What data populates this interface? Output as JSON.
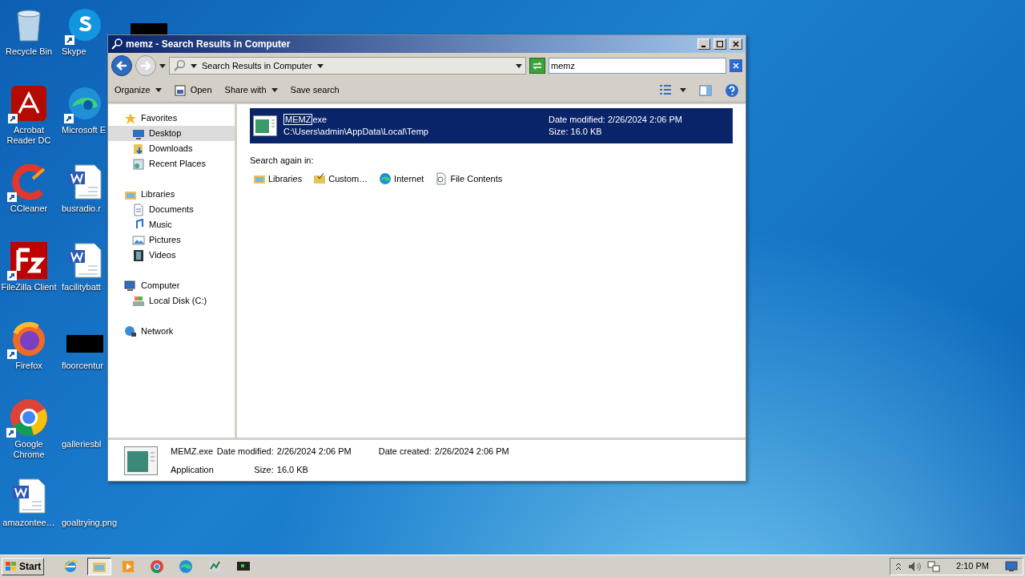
{
  "desktop_icons": [
    {
      "label": "Recycle Bin",
      "kind": "bin",
      "shortcut": false
    },
    {
      "label": "Skype",
      "kind": "skype",
      "shortcut": true
    },
    {
      "label": "Acrobat Reader DC",
      "kind": "acrobat",
      "shortcut": true
    },
    {
      "label": "Microsoft E",
      "kind": "edge",
      "shortcut": true
    },
    {
      "label": "CCleaner",
      "kind": "ccleaner",
      "shortcut": true
    },
    {
      "label": "busradio.r",
      "kind": "word",
      "shortcut": false
    },
    {
      "label": "FileZilla Client",
      "kind": "filezilla",
      "shortcut": true
    },
    {
      "label": "facilitybatt",
      "kind": "word",
      "shortcut": false
    },
    {
      "label": "Firefox",
      "kind": "firefox",
      "shortcut": true
    },
    {
      "label": "floorcentur",
      "kind": "redacted",
      "shortcut": false
    },
    {
      "label": "Google Chrome",
      "kind": "chrome",
      "shortcut": true
    },
    {
      "label": "galleriesbl",
      "kind": "blank",
      "shortcut": false
    },
    {
      "label": "amazontee…",
      "kind": "word",
      "shortcut": false
    },
    {
      "label": "goaltrying.png",
      "kind": "blank",
      "shortcut": false
    }
  ],
  "window": {
    "title": "memz - Search Results in Computer",
    "address": "Search Results in Computer",
    "search": {
      "value": "memz"
    },
    "toolbar": [
      {
        "label": "Organize",
        "kind": "menu"
      },
      {
        "label": "Open",
        "kind": "open"
      },
      {
        "label": "Share with",
        "kind": "menu"
      },
      {
        "label": "Save search",
        "kind": "plain"
      }
    ],
    "sidebar": {
      "items": [
        {
          "label": "Favorites",
          "kind": "star",
          "selected": false,
          "children": [
            {
              "label": "Desktop",
              "kind": "desktop",
              "selected": true
            },
            {
              "label": "Downloads",
              "kind": "downloads",
              "selected": false
            },
            {
              "label": "Recent Places",
              "kind": "recent",
              "selected": false
            }
          ]
        },
        {
          "label": "Libraries",
          "kind": "library",
          "selected": false,
          "children": [
            {
              "label": "Documents",
              "kind": "documents",
              "selected": false
            },
            {
              "label": "Music",
              "kind": "music",
              "selected": false
            },
            {
              "label": "Pictures",
              "kind": "pictures",
              "selected": false
            },
            {
              "label": "Videos",
              "kind": "videos",
              "selected": false
            }
          ]
        },
        {
          "label": "Computer",
          "kind": "computer",
          "selected": false,
          "children": [
            {
              "label": "Local Disk (C:)",
              "kind": "disk",
              "selected": false
            }
          ]
        },
        {
          "label": "Network",
          "kind": "network",
          "selected": false
        }
      ]
    },
    "results": [
      {
        "match": "MEMZ",
        "rest": "exe",
        "path": "C:\\Users\\admin\\AppData\\Local\\Temp",
        "modified": "Date modified: 2/26/2024 2:06 PM",
        "size": "Size: 16.0 KB",
        "selected": true
      }
    ],
    "search_again": {
      "label": "Search again in:",
      "options": [
        {
          "label": "Libraries",
          "kind": "library"
        },
        {
          "label": "Custom…",
          "kind": "custom"
        },
        {
          "label": "Internet",
          "kind": "edge"
        },
        {
          "label": "File Contents",
          "kind": "contents"
        }
      ]
    },
    "details": {
      "name": "MEMZ.exe",
      "type": "Application",
      "modified_label": "Date modified:",
      "modified": "2/26/2024 2:06 PM",
      "size_label": "Size:",
      "size": "16.0 KB",
      "created_label": "Date created:",
      "created": "2/26/2024 2:06 PM"
    }
  },
  "taskbar": {
    "start": "Start",
    "items": [
      {
        "kind": "ie",
        "selected": false
      },
      {
        "kind": "explorer",
        "selected": true
      },
      {
        "kind": "media",
        "selected": false
      },
      {
        "kind": "chrome",
        "selected": false
      },
      {
        "kind": "edge",
        "selected": false
      },
      {
        "kind": "app",
        "selected": false
      },
      {
        "kind": "monitor",
        "selected": false
      }
    ],
    "clock": "2:10 PM"
  }
}
